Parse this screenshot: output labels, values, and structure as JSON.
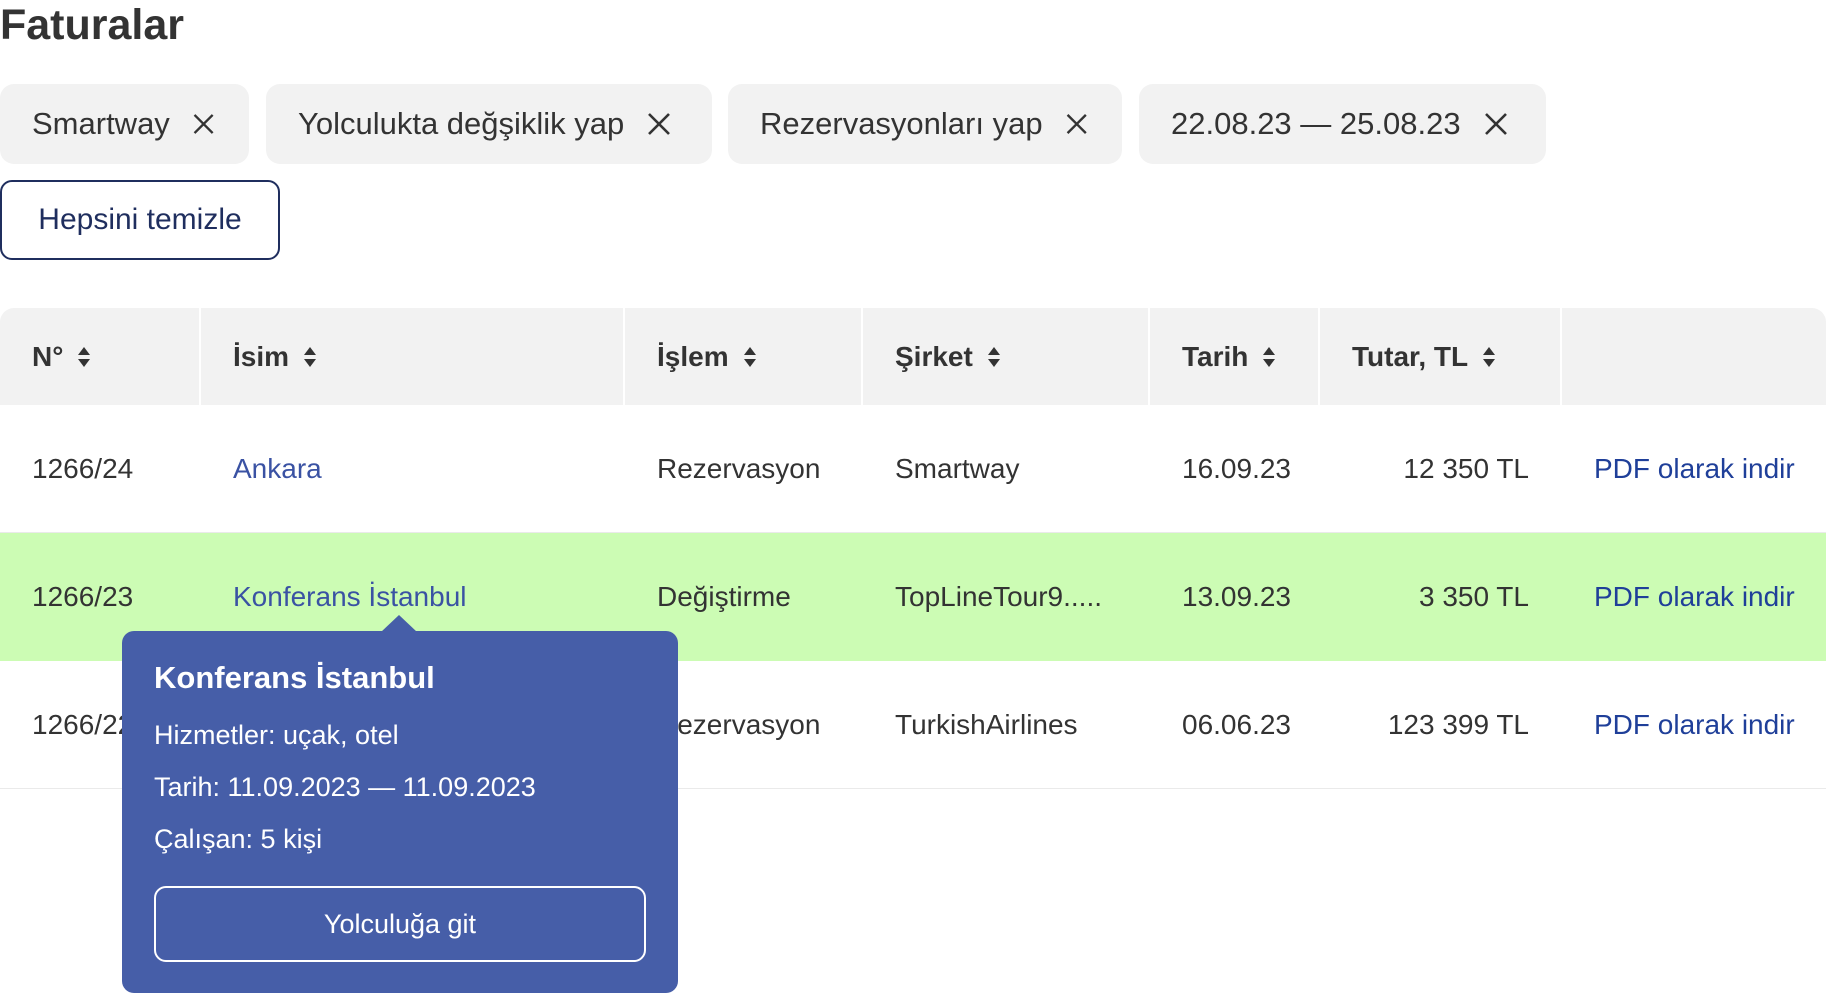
{
  "page": {
    "title": "Faturalar"
  },
  "filters": {
    "chips": [
      {
        "label": "Smartway"
      },
      {
        "label": "Yolculukta değşiklik yap"
      },
      {
        "label": "Rezervasyonları yap"
      },
      {
        "label": "22.08.23 — 25.08.23"
      }
    ],
    "close_icon": "close-icon",
    "clear_all_label": "Hepsini temizle"
  },
  "table": {
    "columns": [
      {
        "label": "N°"
      },
      {
        "label": "İsim"
      },
      {
        "label": "İşlem"
      },
      {
        "label": "Şirket"
      },
      {
        "label": "Tarih"
      },
      {
        "label": "Tutar, TL"
      },
      {
        "label": ""
      }
    ],
    "sort_icon": "sort-icon",
    "rows": [
      {
        "number": "1266/24",
        "name": "Ankara",
        "operation": "Rezervasyon",
        "company": "Smartway",
        "date": "16.09.23",
        "amount": "12 350 TL",
        "action": "PDF olarak indir"
      },
      {
        "number": "1266/23",
        "name": "Konferans İstanbul",
        "operation": "Değiştirme",
        "company": "TopLineTour9.....",
        "date": "13.09.23",
        "amount": "3 350 TL",
        "action": "PDF olarak indir",
        "highlighted": true
      },
      {
        "number": "1266/22",
        "name": "",
        "operation": "Rezervasyon",
        "company": "TurkishAirlines",
        "date": "06.06.23",
        "amount": "123 399 TL",
        "action": "PDF olarak indir"
      }
    ]
  },
  "tooltip": {
    "title": "Konferans İstanbul",
    "services": "Hizmetler: uçak, otel",
    "dates": "Tarih: 11.09.2023 — 11.09.2023",
    "employees": "Çalışan: 5 kişi",
    "button_label": "Yolculuğa git"
  },
  "colors": {
    "highlight_row": "#ccfcb4",
    "tooltip_bg": "#465ea8",
    "link": "#3a52a3",
    "chip_bg": "#f2f2f2",
    "header_bg": "#f2f2f2"
  }
}
